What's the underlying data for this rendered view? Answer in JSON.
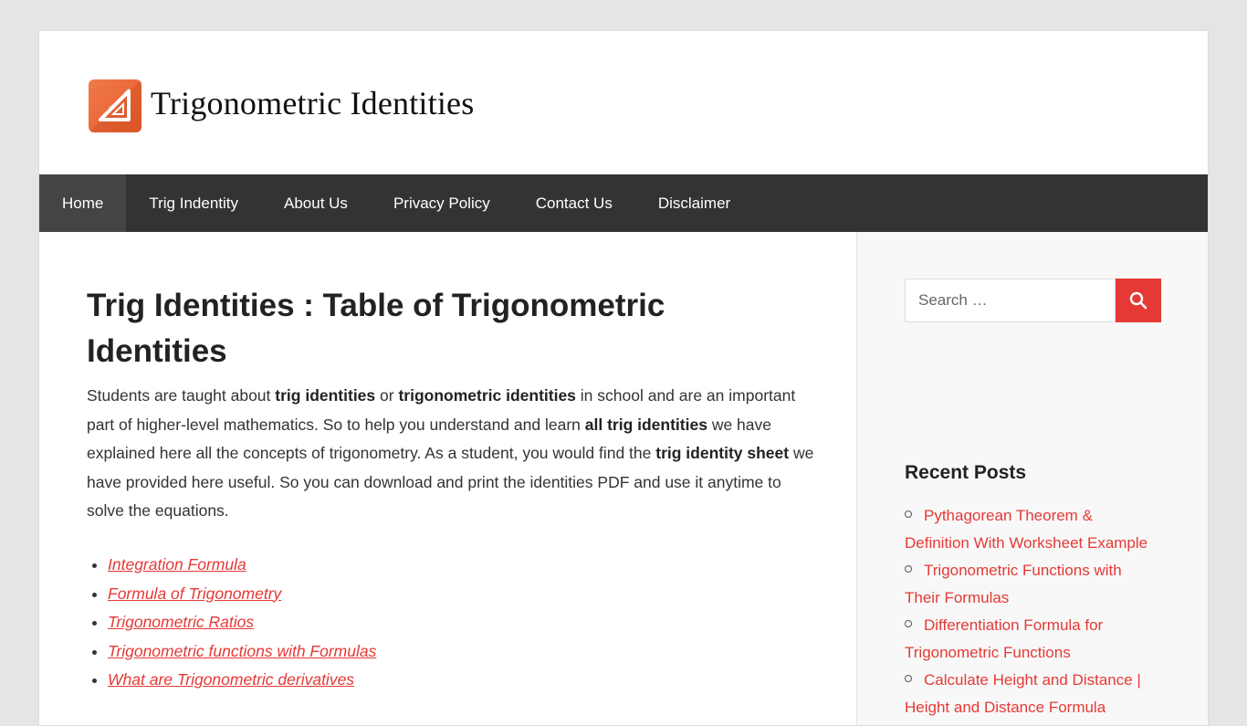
{
  "site": {
    "title": "Trigonometric Identities",
    "logo_text": "Trigonometric",
    "brand_color": "#e55a2b",
    "accent_color": "#e53935"
  },
  "nav": {
    "items": [
      {
        "label": "Home",
        "active": true
      },
      {
        "label": "Trig Indentity"
      },
      {
        "label": "About Us"
      },
      {
        "label": "Privacy Policy"
      },
      {
        "label": "Contact Us"
      },
      {
        "label": "Disclaimer"
      }
    ]
  },
  "article": {
    "title": "Trig Identities : Table of Trigonometric Identities",
    "intro": [
      {
        "t": "Students are taught about "
      },
      {
        "t": "trig identities",
        "b": true
      },
      {
        "t": " or "
      },
      {
        "t": "trigonometric identities",
        "b": true
      },
      {
        "t": " in school and are an important part of higher-level mathematics. So to help you understand and learn "
      },
      {
        "t": "all trig identities",
        "b": true
      },
      {
        "t": " we have explained here all the concepts of trigonometry. As a student, you would find the "
      },
      {
        "t": "trig identity sheet",
        "b": true
      },
      {
        "t": " we have provided here useful. So you can download and print the identities PDF and use it anytime to solve the equations."
      }
    ],
    "links": [
      "Integration Formula",
      "Formula of Trigonometry",
      "Trigonometric Ratios",
      "Trigonometric functions with Formulas",
      "What are Trigonometric derivatives"
    ]
  },
  "sidebar": {
    "search": {
      "placeholder": "Search …",
      "icon": "search-icon"
    },
    "recent_title": "Recent Posts",
    "recent_posts": [
      "Pythagorean Theorem & Definition With Worksheet Example",
      "Trigonometric Functions with Their Formulas",
      "Differentiation Formula for Trigonometric Functions",
      "Calculate Height and Distance | Height and Distance Formula"
    ]
  }
}
